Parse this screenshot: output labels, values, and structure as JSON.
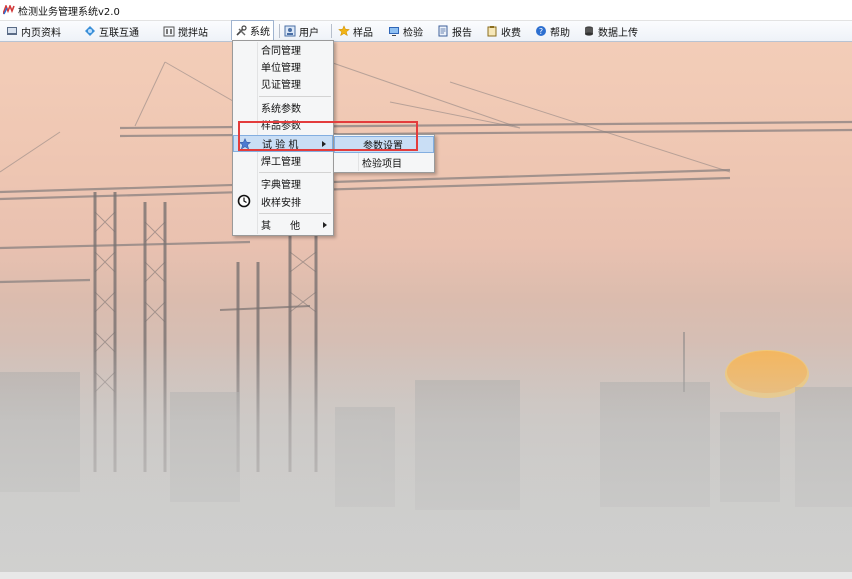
{
  "window": {
    "title": "检测业务管理系统v2.0"
  },
  "menubar": {
    "items": [
      {
        "label": "内页资料",
        "icon": "book-icon"
      },
      {
        "label": "互联互通",
        "icon": "network-icon"
      },
      {
        "label": "搅拌站",
        "icon": "building-icon"
      },
      {
        "label": "系统",
        "icon": "tools-icon"
      },
      {
        "label": "用户",
        "icon": "user-icon"
      },
      {
        "label": "样品",
        "icon": "star-icon"
      },
      {
        "label": "检验",
        "icon": "monitor-icon"
      },
      {
        "label": "报告",
        "icon": "report-icon"
      },
      {
        "label": "收费",
        "icon": "clipboard-icon"
      },
      {
        "label": "帮助",
        "icon": "help-icon"
      },
      {
        "label": "数据上传",
        "icon": "database-icon"
      }
    ]
  },
  "system_menu": {
    "items": [
      {
        "label": "合同管理"
      },
      {
        "label": "单位管理"
      },
      {
        "label": "见证管理"
      },
      {
        "label": "系统参数"
      },
      {
        "label": "样品参数"
      },
      {
        "label": "试 验 机"
      },
      {
        "label": "焊工管理"
      },
      {
        "label": "字典管理"
      },
      {
        "label": "收样安排"
      },
      {
        "label": "其      他"
      }
    ]
  },
  "submenu": {
    "items": [
      {
        "label": "参数设置"
      },
      {
        "label": "检验项目"
      }
    ]
  },
  "colors": {
    "highlight_border": "#e33c3c",
    "menu_hover": "#c9def5",
    "sky_top": "#f3cdb8"
  }
}
